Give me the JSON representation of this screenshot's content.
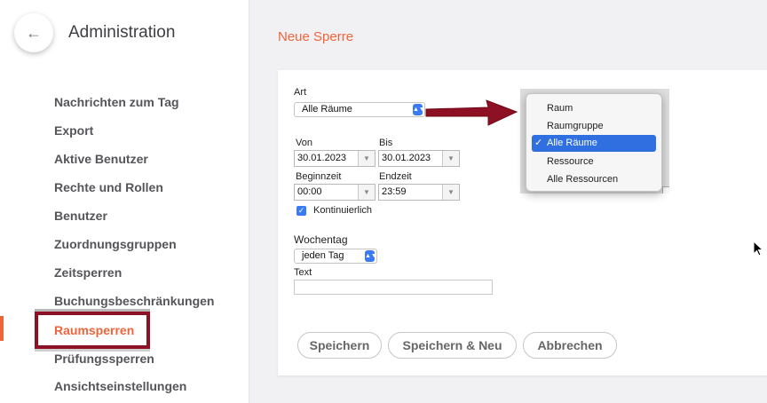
{
  "sidebar": {
    "back_icon": "arrow-left-icon",
    "title": "Administration",
    "items": [
      {
        "label": "Nachrichten zum Tag"
      },
      {
        "label": "Export"
      },
      {
        "label": "Aktive Benutzer"
      },
      {
        "label": "Rechte und Rollen"
      },
      {
        "label": "Benutzer"
      },
      {
        "label": "Zuordnungsgruppen"
      },
      {
        "label": "Zeitsperren"
      },
      {
        "label": "Buchungsbeschränkungen"
      },
      {
        "label": "Raumsperren",
        "active": true
      },
      {
        "label": "Prüfungssperren"
      },
      {
        "label": "Ansichtseinstellungen"
      }
    ]
  },
  "main": {
    "title": "Neue Sperre",
    "form": {
      "art_label": "Art",
      "art_value": "Alle Räume",
      "von_label": "Von",
      "von_value": "30.01.2023",
      "bis_label": "Bis",
      "bis_value": "30.01.2023",
      "beginn_label": "Beginnzeit",
      "beginn_value": "00:00",
      "end_label": "Endzeit",
      "end_value": "23:59",
      "kontinuierlich_label": "Kontinuierlich",
      "kontinuierlich_checked": true,
      "wochentag_label": "Wochentag",
      "wochentag_value": "jeden Tag",
      "text_label": "Text",
      "text_value": ""
    },
    "buttons": {
      "save": "Speichern",
      "save_new": "Speichern & Neu",
      "cancel": "Abbrechen"
    }
  },
  "dropdown": {
    "options": [
      "Raum",
      "Raumgruppe",
      "Alle Räume",
      "Ressource",
      "Alle Ressourcen"
    ],
    "selected": "Alle Räume"
  },
  "colors": {
    "accent": "#f0643c",
    "annotation": "#8e1024",
    "selection": "#2f6fe0"
  }
}
